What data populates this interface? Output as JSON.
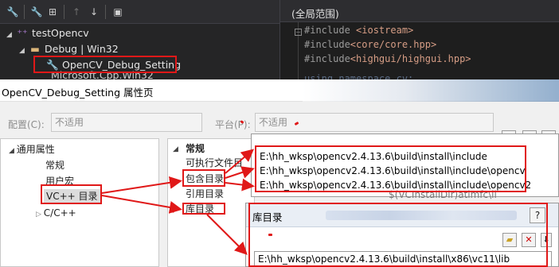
{
  "solution_explorer": {
    "project_name": "testOpencv",
    "config_node": "Debug | Win32",
    "property_sheet": "OpenCV_Debug_Setting",
    "hidden_row": "Microsoft.Cpp.Win32"
  },
  "code_editor": {
    "scope": "(全局范围)",
    "lines": [
      {
        "directive": "#include ",
        "target": "<iostream>"
      },
      {
        "directive": "#include",
        "target": "<core/core.hpp>"
      },
      {
        "directive": "#include",
        "target": "<highgui/highgui.hpp>"
      },
      {
        "directive": "",
        "target": "using namespace cv;"
      }
    ]
  },
  "dialog": {
    "title": "OpenCV_Debug_Setting 属性页",
    "config_label": "配置(C):",
    "config_value": "不适用",
    "platform_label": "平台(P):",
    "platform_value": "不适用"
  },
  "left_tree": {
    "root": "通用属性",
    "items": [
      "常规",
      "用户宏",
      "VC++ 目录",
      "C/C++"
    ]
  },
  "mid_list": {
    "header": "常规",
    "items": [
      "可执行文件目",
      "包含目录",
      "引用目录",
      "库目录"
    ]
  },
  "include_popup": {
    "paths": [
      "E:\\hh_wksp\\opencv2.4.13.6\\build\\install\\include",
      "E:\\hh_wksp\\opencv2.4.13.6\\build\\install\\include\\opencv",
      "E:\\hh_wksp\\opencv2.4.13.6\\build\\install\\include\\opencv2"
    ]
  },
  "background_macro": "$(VCInstallDir)atlmfc\\li",
  "lib_popup": {
    "title": "库目录",
    "help_glyph": "?",
    "path": "E:\\hh_wksp\\opencv2.4.13.6\\build\\install\\x86\\vc11\\lib"
  },
  "colors": {
    "annotation_red": "#e01818",
    "editor_bg": "#1e1e1e",
    "explorer_bg": "#252526"
  }
}
